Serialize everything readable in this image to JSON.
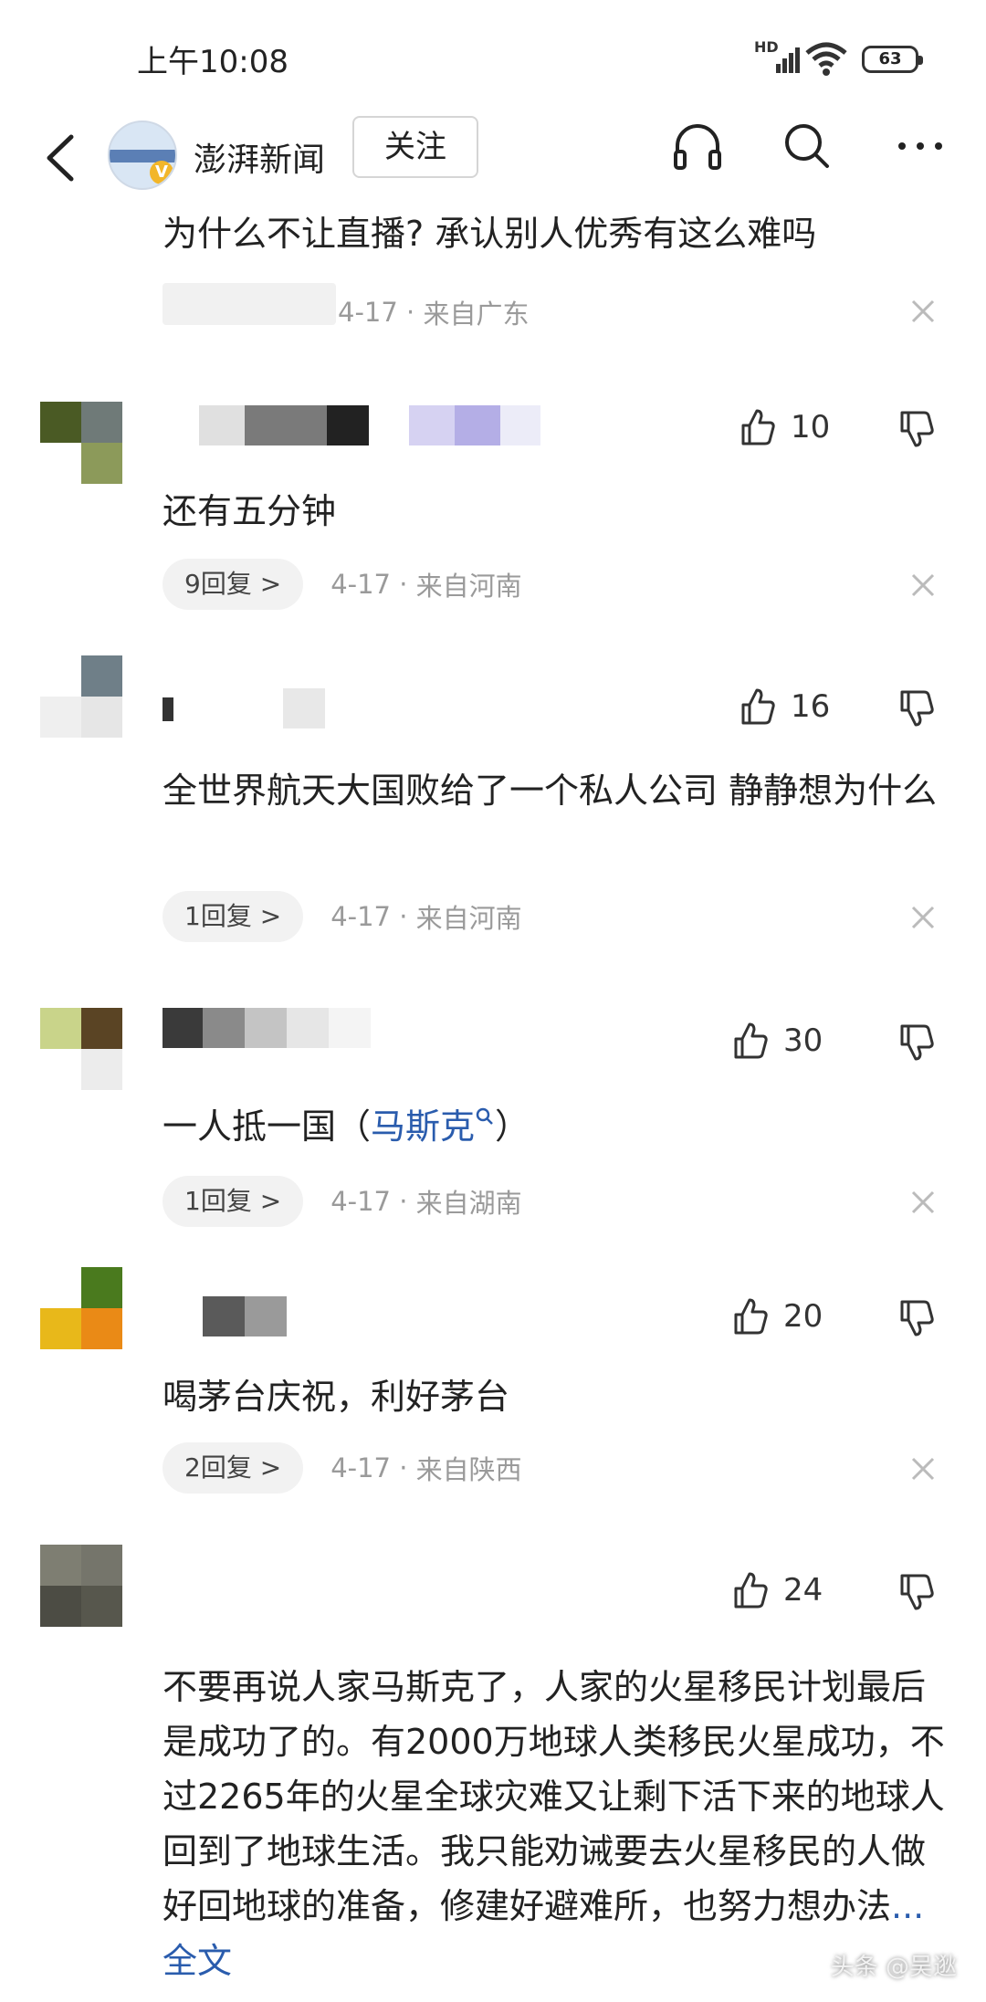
{
  "status_bar": {
    "time": "上午10:08",
    "network": "HD",
    "battery": "63"
  },
  "header": {
    "brand": "澎湃新闻",
    "follow_label": "关注",
    "icons": [
      "back-icon",
      "headphones-icon",
      "search-icon",
      "more-icon"
    ]
  },
  "comments": [
    {
      "text": "为什么不让直播? 承认别人优秀有这么难吗",
      "date": "4-17",
      "location": "来自广东"
    },
    {
      "likes": "10",
      "text": "还有五分钟",
      "replies": "9回复 >",
      "date": "4-17",
      "location": "来自河南"
    },
    {
      "likes": "16",
      "text": "全世界航天大国败给了一个私人公司 静静想为什么",
      "replies": "1回复 >",
      "date": "4-17",
      "location": "来自河南"
    },
    {
      "likes": "30",
      "text_before": "一人抵一国（",
      "link": "马斯克",
      "text_after": "）",
      "replies": "1回复 >",
      "date": "4-17",
      "location": "来自湖南"
    },
    {
      "likes": "20",
      "text": "喝茅台庆祝，利好茅台",
      "replies": "2回复 >",
      "date": "4-17",
      "location": "来自陕西"
    },
    {
      "likes": "24",
      "text": "不要再说人家马斯克了，人家的火星移民计划最后是成功了的。有2000万地球人类移民火星成功，不过2265年的火星全球灾难又让剩下活下来的地球人回到了地球生活。我只能劝诫要去火星移民的人做好回地球的准备，修建好避难所，也努力想办法",
      "more": "...全文"
    }
  ],
  "watermark": "头条 @吴逖",
  "colors": {
    "link": "#2a5cad",
    "text": "#222222",
    "meta": "#9a9a9a",
    "pill_bg": "#f2f2f2"
  }
}
